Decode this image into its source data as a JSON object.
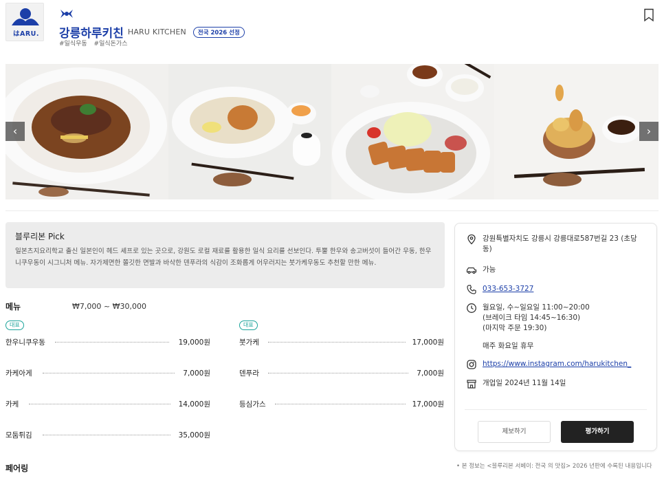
{
  "restaurant": {
    "logo_text": "はARU.",
    "name_ko": "강릉하루키친",
    "name_en": "HARU KITCHEN",
    "badge": "전국 2026 선정",
    "tags": [
      "#일식우동",
      "#일식돈가스"
    ]
  },
  "gallery": {
    "prev_label": "‹",
    "next_label": "›"
  },
  "pick": {
    "title": "블루리본 Pick",
    "body": "일본츠지요리학교 출신 일본인이 헤드 셰프로 있는 곳으로, 강원도 로컬 재료를 활용한 일식 요리를 선보인다. 투뿔 한우와 송고버섯이 들어간 우동, 한우니쿠우동이 시그니처 메뉴. 자가제면한 쫄깃한 면발과 바삭한 덴푸라의 식감이 조화롭게 어우러지는 붓가케우동도 추천할 만한 메뉴."
  },
  "menu": {
    "title": "메뉴",
    "price_range": "₩7,000 ~ ₩30,000",
    "rep_label": "대표",
    "items": [
      {
        "name": "한우니쿠우동",
        "price": "19,000원",
        "representative": true
      },
      {
        "name": "붓가케",
        "price": "17,000원",
        "representative": true
      },
      {
        "name": "카케아게",
        "price": "7,000원"
      },
      {
        "name": "덴푸라",
        "price": "7,000원"
      },
      {
        "name": "카케",
        "price": "14,000원"
      },
      {
        "name": "등심가스",
        "price": "17,000원"
      },
      {
        "name": "모둠튀김",
        "price": "35,000원"
      }
    ]
  },
  "pairing": {
    "title": "페어링"
  },
  "info": {
    "address": "강원특별자치도 강릉시 강릉대로587번길 23 (초당동)",
    "parking": "가능",
    "phone": "033-653-3727",
    "hours_1": "월요일, 수~일요일 11:00~20:00",
    "hours_2": "(브레이크 타임 14:45~16:30)",
    "hours_3": "(마지막 주문 19:30)",
    "holiday": "매주 화요일 휴무",
    "instagram": "https://www.instagram.com/harukitchen_",
    "opened": "개업일 2024년 11월 14일",
    "report_button": "제보하기",
    "rate_button": "평가하기"
  },
  "notice": "• 본 정보는 <블루리본 서베이: 전국 의 맛집> 2026 년판에 수록된 내용입니다",
  "colors": {
    "brand_blue": "#1c3fa8",
    "badge_teal": "#1aa39a",
    "dark_button": "#222222"
  }
}
